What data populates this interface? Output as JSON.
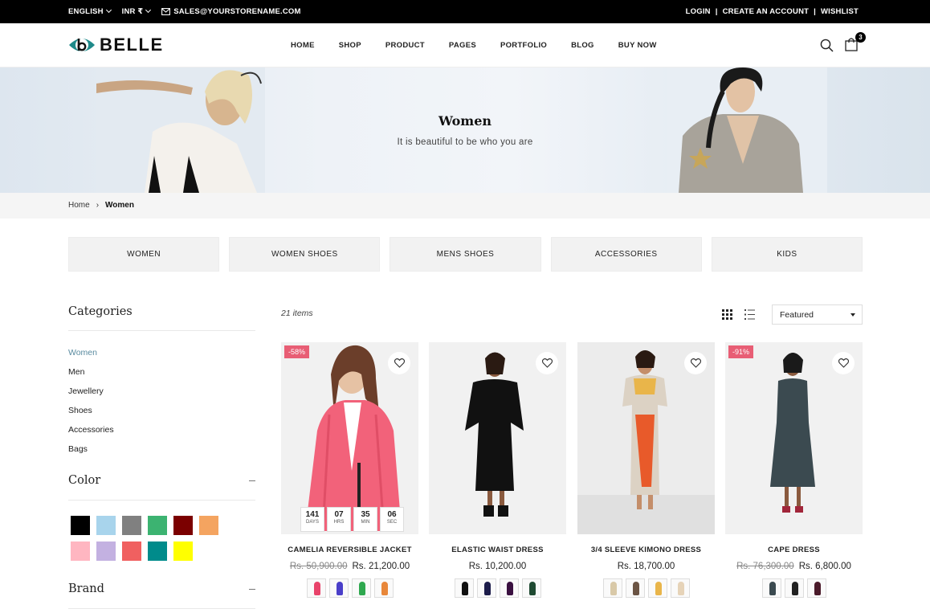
{
  "topbar": {
    "language": "ENGLISH",
    "currency": "INR ₹",
    "email": "SALES@YOURSTORENAME.COM",
    "login": "LOGIN",
    "create_account": "CREATE AN ACCOUNT",
    "wishlist": "WISHLIST",
    "separator": "|"
  },
  "header": {
    "logo_text": "BELLE",
    "nav": [
      "HOME",
      "SHOP",
      "PRODUCT",
      "PAGES",
      "PORTFOLIO",
      "BLOG",
      "BUY NOW"
    ],
    "cart_count": "3"
  },
  "banner": {
    "title": "Women",
    "subtitle": "It is beautiful to be who you are"
  },
  "breadcrumb": {
    "home": "Home",
    "separator": "›",
    "current": "Women"
  },
  "category_tiles": [
    "WOMEN",
    "WOMEN SHOES",
    "MENS SHOES",
    "ACCESSORIES",
    "KIDS"
  ],
  "sidebar": {
    "categories_title": "Categories",
    "categories": [
      "Women",
      "Men",
      "Jewellery",
      "Shoes",
      "Accessories",
      "Bags"
    ],
    "active_category": "Women",
    "color_title": "Color",
    "colors": [
      "#000000",
      "#a8d4ec",
      "#808080",
      "#3cb371",
      "#7b0000",
      "#f4a460",
      "#ffb6c1",
      "#c3b1e1",
      "#f06060",
      "#008b8b",
      "#ffff00"
    ],
    "brand_title": "Brand"
  },
  "toolbar": {
    "items_count": "21 items",
    "sort_selected": "Featured"
  },
  "products": [
    {
      "name": "CAMELIA REVERSIBLE JACKET",
      "old_price": "Rs. 50,900.00",
      "price": "Rs. 21,200.00",
      "badge": "-58%",
      "timer": [
        {
          "value": "141",
          "label": "DAYS"
        },
        {
          "value": "07",
          "label": "HRS"
        },
        {
          "value": "35",
          "label": "MIN"
        },
        {
          "value": "06",
          "label": "SEC"
        }
      ],
      "swatch_colors": [
        "#e8436a",
        "#4a3fc9",
        "#2fa84f",
        "#e8873a"
      ]
    },
    {
      "name": "ELASTIC WAIST DRESS",
      "old_price": "",
      "price": "Rs. 10,200.00",
      "badge": "",
      "swatch_colors": [
        "#111111",
        "#1c1c4a",
        "#3a1040",
        "#1f4a32"
      ]
    },
    {
      "name": "3/4 SLEEVE KIMONO DRESS",
      "old_price": "",
      "price": "Rs. 18,700.00",
      "badge": "",
      "swatch_colors": [
        "#d9c9a8",
        "#6b5444",
        "#e9b54a",
        "#e6d3b8"
      ]
    },
    {
      "name": "CAPE DRESS",
      "old_price": "Rs. 76,300.00",
      "price": "Rs. 6,800.00",
      "badge": "-91%",
      "swatch_colors": [
        "#3b4a50",
        "#222222",
        "#4a1a2a"
      ]
    }
  ]
}
